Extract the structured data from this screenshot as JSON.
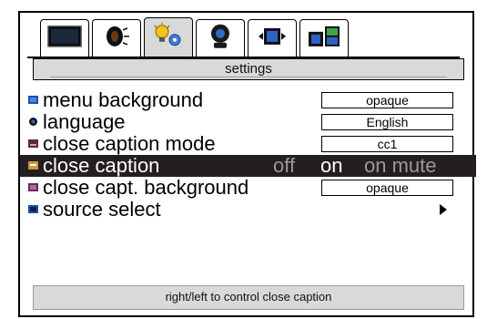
{
  "tabs": [
    {
      "icon": "monitor-icon",
      "active": false
    },
    {
      "icon": "speaker-icon",
      "active": false
    },
    {
      "icon": "settings-lightbulb-icon",
      "active": true
    },
    {
      "icon": "satellite-dish-icon",
      "active": false
    },
    {
      "icon": "picture-position-icon",
      "active": false
    },
    {
      "icon": "pip-icon",
      "active": false
    }
  ],
  "header": {
    "title": "settings"
  },
  "menu": {
    "items": [
      {
        "label": "menu background",
        "value": "opaque"
      },
      {
        "label": "language",
        "value": "English"
      },
      {
        "label": "close caption mode",
        "value": "cc1"
      },
      {
        "label": "close caption",
        "options": [
          "off",
          "on",
          "on mute"
        ],
        "selected": "on"
      },
      {
        "label": "close capt. background",
        "value": "opaque"
      },
      {
        "label": "source select"
      }
    ]
  },
  "hint": {
    "text": "right/left to control close caption"
  },
  "colors": {
    "panel_gray": "#d9d9d9",
    "highlight": "#231f20",
    "dim_option": "#9a9a9a",
    "blue_bullet": "#1e4fa8"
  }
}
